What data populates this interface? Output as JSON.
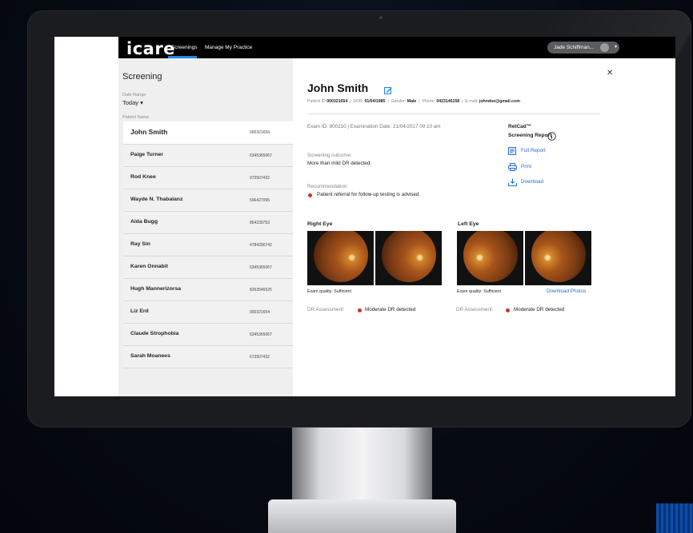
{
  "app": {
    "logo": "icare"
  },
  "topnav": {
    "items": [
      {
        "label": "Screenings"
      },
      {
        "label": "Manage My Practice"
      }
    ],
    "user": "Jade Schiffman...",
    "accent": "#1e88e5"
  },
  "sidebar": {
    "title": "Screening",
    "date_range_label": "Date Range",
    "date_range_value": "Today",
    "patient_name_label": "Patient Name",
    "patients": [
      {
        "name": "John Smith",
        "id": "000321654"
      },
      {
        "name": "Paige Turner",
        "id": "6345365067"
      },
      {
        "name": "Rod Knee",
        "id": "973507432"
      },
      {
        "name": "Wayde N. Thabalanz",
        "id": "596427095"
      },
      {
        "name": "Aida Bugg",
        "id": "864239753"
      },
      {
        "name": "Ray Sin",
        "id": "4784290742"
      },
      {
        "name": "Karen Onnabit",
        "id": "6345365067"
      },
      {
        "name": "Hugh Mannerizorsa",
        "id": "8263546525"
      },
      {
        "name": "Liz Erd",
        "id": "000321654"
      },
      {
        "name": "Claude Strophobia",
        "id": "6345365067"
      },
      {
        "name": "Sarah Moanees",
        "id": "673507432"
      }
    ]
  },
  "detail": {
    "name": "John Smith",
    "meta": {
      "pid_label": "Patient ID",
      "pid": "000321654",
      "dob_label": "DOB:",
      "dob": "01/04/1985",
      "gender_label": "Gender:",
      "gender": "Male",
      "phone_label": "Phone:",
      "phone": "0423146158",
      "email_label": "E-mail:",
      "email": "johndoe@gmail.com"
    },
    "exam_line": "Exam ID: 800210  |  Examination Date: 21/04/2017  09:10 am",
    "screening_outcome_label": "Screening outcome:",
    "screening_outcome": "More than mild DR detected.",
    "recommendation_label": "Recommendation:",
    "recommendation": "Patient referral for follow-up testing is advised.",
    "report": {
      "title": "RetCad™",
      "subtitle": "Screening Report",
      "actions": [
        {
          "label": "Full Report"
        },
        {
          "label": "Print"
        },
        {
          "label": "Download"
        }
      ]
    },
    "right_eye": {
      "title": "Right Eye",
      "exam_quality": "Exam quality:  Sufficient",
      "dr_label": "DR Assessment:",
      "dr_value": "Moderate DR detected"
    },
    "left_eye": {
      "title": "Left Eye",
      "exam_quality": "Exam quality:  Sufficient",
      "dr_label": "DR Assessment:",
      "dr_value": "Moderate DR detected"
    },
    "download_photos": "Download Photos",
    "alert_color": "#d32f2f"
  }
}
